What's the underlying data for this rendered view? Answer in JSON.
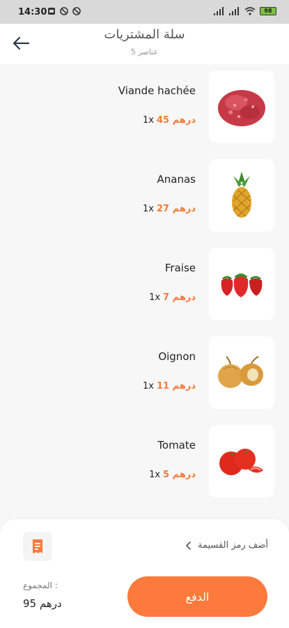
{
  "status": {
    "time": "14:30",
    "battery": "98"
  },
  "header": {
    "title": "سلة المشتريات",
    "subtitle": "عناصر 5"
  },
  "items": [
    {
      "name": "Viande hachée",
      "qty": "1x",
      "price": "45 درهم",
      "image": "minced-meat"
    },
    {
      "name": "Ananas",
      "qty": "1x",
      "price": "27 درهم",
      "image": "pineapple"
    },
    {
      "name": "Fraise",
      "qty": "1x",
      "price": "7 درهم",
      "image": "strawberry"
    },
    {
      "name": "Oignon",
      "qty": "1x",
      "price": "11 درهم",
      "image": "onion"
    },
    {
      "name": "Tomate",
      "qty": "1x",
      "price": "5 درهم",
      "image": "tomato"
    }
  ],
  "footer": {
    "coupon_label": "أضف رمز القسيمة",
    "total_label": "المجموع :",
    "total_value": "95 درهم",
    "pay_label": "الدفع"
  },
  "colors": {
    "accent": "#fb7a3c",
    "price": "#f47b3a"
  }
}
